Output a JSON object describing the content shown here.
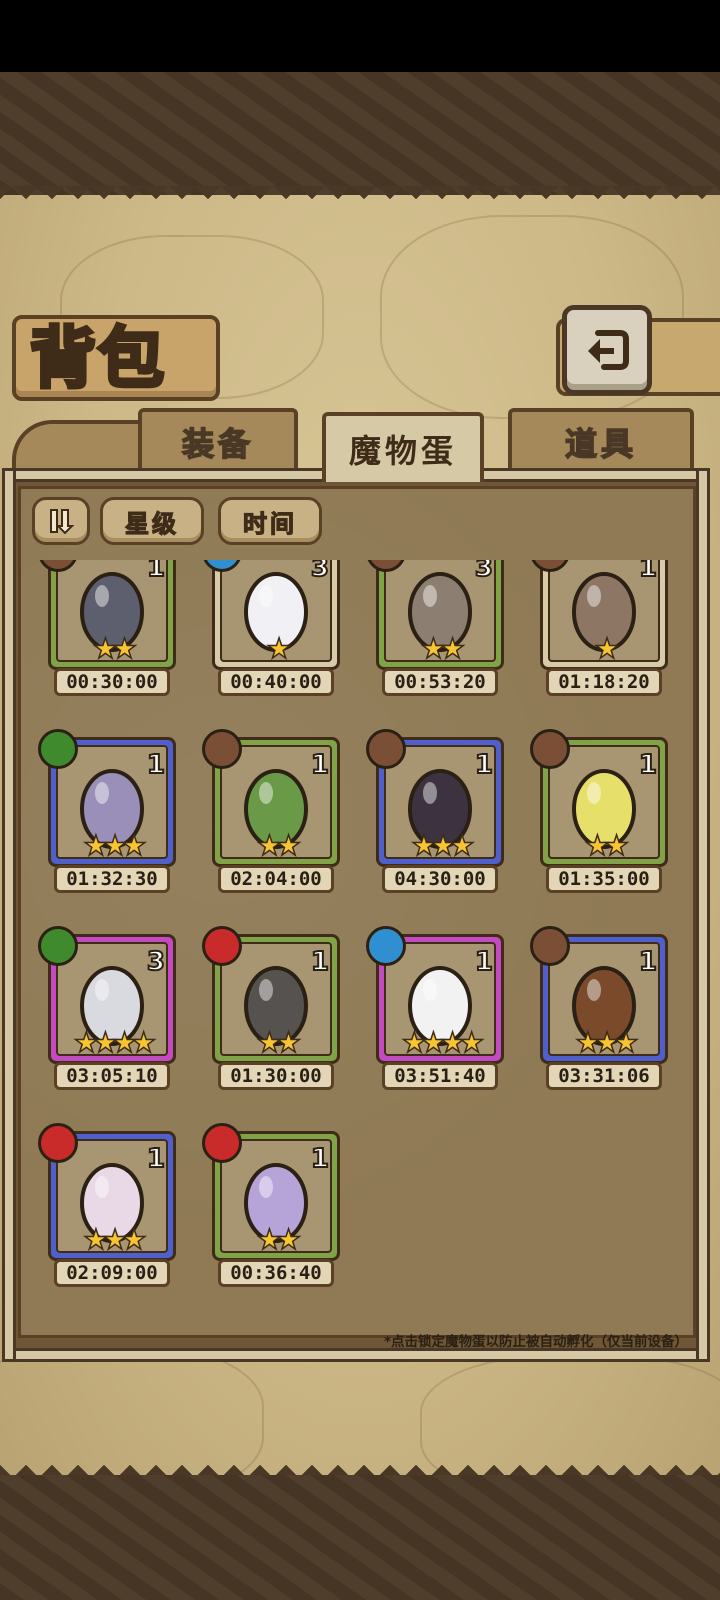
{
  "title": "背包",
  "tabs": [
    {
      "label": "装备",
      "active": false
    },
    {
      "label": "魔物蛋",
      "active": true
    },
    {
      "label": "道具",
      "active": false
    }
  ],
  "sort_buttons": {
    "sort_a": "星级",
    "sort_b": "时间"
  },
  "hint": "*点击锁定魔物蛋以防止被自动孵化（仅当前设备）",
  "colors": {
    "green_frame": "#7fa346",
    "blue_frame": "#4f5fcc",
    "pink_frame": "#c34ac0",
    "tan_frame": "#d8cba8"
  },
  "eggs": [
    {
      "element": "earth",
      "frame": "green",
      "count": "1",
      "stars": "★★",
      "timer": "00:30:00",
      "egg_color": "#5e5f6e"
    },
    {
      "element": "water",
      "frame": "tan",
      "count": "3",
      "stars": "★",
      "timer": "00:40:00",
      "egg_color": "#f1f1f5"
    },
    {
      "element": "earth",
      "frame": "green",
      "count": "3",
      "stars": "★★",
      "timer": "00:53:20",
      "egg_color": "#8c7f72"
    },
    {
      "element": "earth",
      "frame": "tan",
      "count": "1",
      "stars": "★",
      "timer": "01:18:20",
      "egg_color": "#8d7764"
    },
    {
      "element": "grass",
      "frame": "blue",
      "count": "1",
      "stars": "★★★",
      "timer": "01:32:30",
      "egg_color": "#9a8fb8"
    },
    {
      "element": "earth",
      "frame": "green",
      "count": "1",
      "stars": "★★",
      "timer": "02:04:00",
      "egg_color": "#6a9a48"
    },
    {
      "element": "earth",
      "frame": "blue",
      "count": "1",
      "stars": "★★★",
      "timer": "04:30:00",
      "egg_color": "#3d3340"
    },
    {
      "element": "earth",
      "frame": "green",
      "count": "1",
      "stars": "★★",
      "timer": "01:35:00",
      "egg_color": "#e6df6a"
    },
    {
      "element": "grass",
      "frame": "pink",
      "count": "3",
      "stars": "★★★★",
      "timer": "03:05:10",
      "egg_color": "#d9d9e0"
    },
    {
      "element": "fire",
      "frame": "green",
      "count": "1",
      "stars": "★★",
      "timer": "01:30:00",
      "egg_color": "#55524f"
    },
    {
      "element": "water",
      "frame": "pink",
      "count": "1",
      "stars": "★★★★",
      "timer": "03:51:40",
      "egg_color": "#f2f2f2"
    },
    {
      "element": "earth",
      "frame": "blue",
      "count": "1",
      "stars": "★★★",
      "timer": "03:31:06",
      "egg_color": "#7a4a2a"
    },
    {
      "element": "fire",
      "frame": "blue",
      "count": "1",
      "stars": "★★★",
      "timer": "02:09:00",
      "egg_color": "#e9d9e6"
    },
    {
      "element": "fire",
      "frame": "green",
      "count": "1",
      "stars": "★★",
      "timer": "00:36:40",
      "egg_color": "#b6a3d8"
    }
  ]
}
